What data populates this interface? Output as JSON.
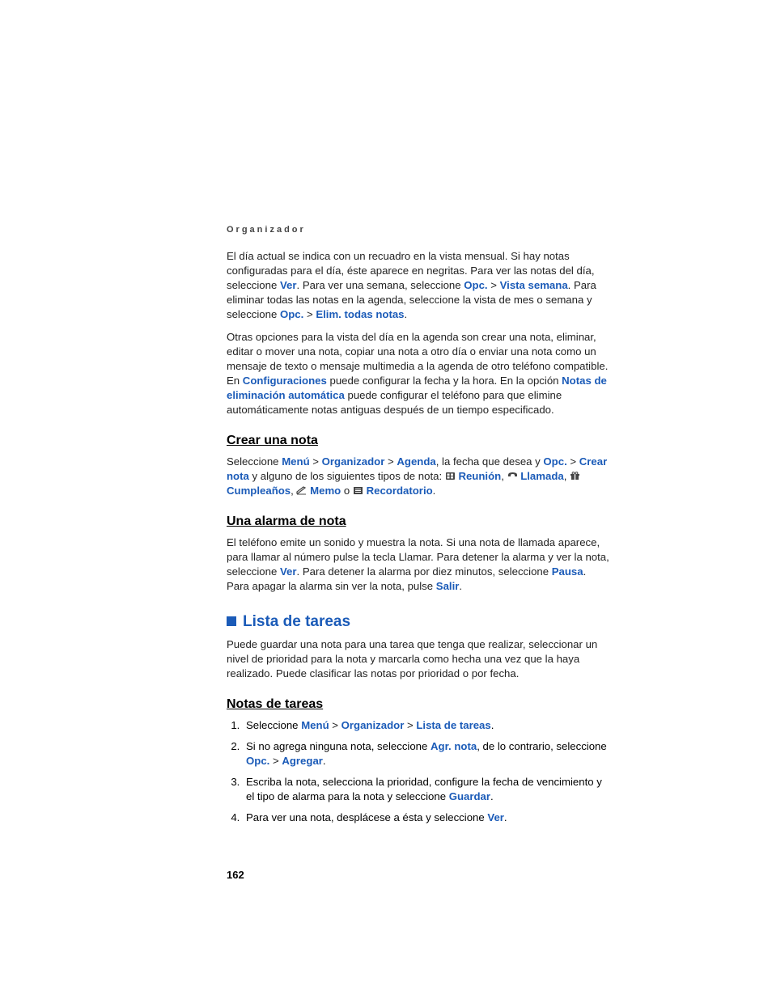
{
  "header": "Organizador",
  "p1": {
    "t1": "El día actual se indica con un recuadro en la vista mensual. Si hay notas configuradas para el día, éste aparece en negritas. Para ver las notas del día, seleccione ",
    "l1": "Ver",
    "t2": ". Para ver una semana, seleccione ",
    "l2": "Opc.",
    "t3": " > ",
    "l3": "Vista semana",
    "t4": ". Para eliminar todas las notas en la agenda, seleccione la vista de mes o semana y seleccione ",
    "l4": "Opc.",
    "t5": " > ",
    "l5": "Elim. todas notas",
    "t6": "."
  },
  "p2": {
    "t1": "Otras opciones para la vista del día en la agenda son crear una nota, eliminar, editar o mover una nota, copiar una nota a otro día o enviar una nota como un mensaje de texto o mensaje multimedia a la agenda de otro teléfono compatible. En ",
    "l1": "Configuraciones",
    "t2": " puede configurar la fecha y la hora. En la opción ",
    "l2": "Notas de eliminación automática",
    "t3": " puede configurar el teléfono para que elimine automáticamente notas antiguas después de un tiempo especificado."
  },
  "h_crear": "Crear una nota",
  "p3": {
    "t1": "Seleccione ",
    "l1": "Menú",
    "t2": " > ",
    "l2": "Organizador",
    "t3": " > ",
    "l3": "Agenda",
    "t4": ", la fecha que desea y ",
    "l4": "Opc.",
    "t5": " > ",
    "l5": "Crear nota",
    "t6": " y alguno de los siguientes tipos de nota: ",
    "l6": "Reunión",
    "t7": ", ",
    "l7": "Llamada",
    "t8": ", ",
    "l8": "Cumpleaños",
    "t9": ", ",
    "l9": "Memo",
    "t10": " o ",
    "l10": "Recordatorio",
    "t11": "."
  },
  "h_alarma": "Una alarma de nota",
  "p4": {
    "t1": "El teléfono emite un sonido y muestra la nota. Si una nota de llamada aparece, para llamar al número pulse la tecla Llamar. Para detener la alarma y ver la nota, seleccione ",
    "l1": "Ver",
    "t2": ". Para detener la alarma por diez minutos, seleccione ",
    "l2": "Pausa",
    "t3": ". Para apagar la alarma sin ver la nota, pulse ",
    "l3": "Salir",
    "t4": "."
  },
  "h_lista": "Lista de tareas",
  "p5": "Puede guardar una nota para una tarea que tenga que realizar, seleccionar un nivel de prioridad para la nota y marcarla como hecha una vez que la haya realizado. Puede clasificar las notas por prioridad o por fecha.",
  "h_notas": "Notas de tareas",
  "li1": {
    "t1": "Seleccione ",
    "l1": "Menú",
    "t2": " > ",
    "l2": "Organizador",
    "t3": " > ",
    "l3": "Lista de tareas",
    "t4": "."
  },
  "li2": {
    "t1": "Si no agrega ninguna nota, seleccione ",
    "l1": "Agr. nota",
    "t2": ", de lo contrario, seleccione ",
    "l2": "Opc.",
    "t3": " > ",
    "l3": "Agregar",
    "t4": "."
  },
  "li3": {
    "t1": "Escriba la nota, selecciona la prioridad, configure la fecha de vencimiento y el tipo de alarma para la nota y seleccione ",
    "l1": "Guardar",
    "t2": "."
  },
  "li4": {
    "t1": "Para ver una nota, desplácese a ésta y seleccione ",
    "l1": "Ver",
    "t2": "."
  },
  "pagenum": "162"
}
